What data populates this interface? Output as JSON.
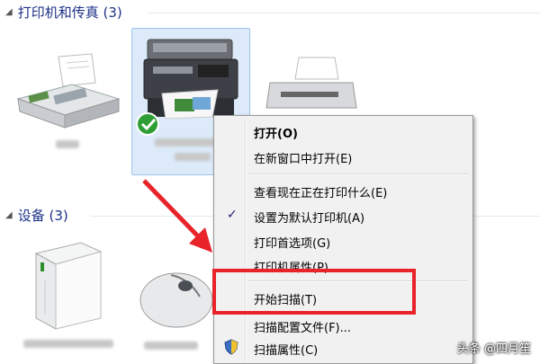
{
  "sections": {
    "printers_header": "打印机和传真 (3)",
    "devices_header": "设备 (3)"
  },
  "context_menu": {
    "items": [
      {
        "label": "打开(O)",
        "bold": true
      },
      {
        "label": "在新窗口中打开(E)"
      },
      {
        "label": "查看现在正在打印什么(E)"
      },
      {
        "label": "设置为默认打印机(A)",
        "checked": true
      },
      {
        "label": "打印首选项(G)"
      },
      {
        "label": "打印机属性(P)"
      },
      {
        "label": "开始扫描(T)"
      },
      {
        "label": "扫描配置文件(F)..."
      },
      {
        "label": "扫描属性(C)",
        "icon": "shield-icon"
      }
    ]
  },
  "watermark": "头条 @四月笙",
  "colors": {
    "header_text": "#1e3287",
    "selection": "#dceaf9",
    "highlight_box": "#e8232a",
    "arrow": "#e8232a"
  }
}
